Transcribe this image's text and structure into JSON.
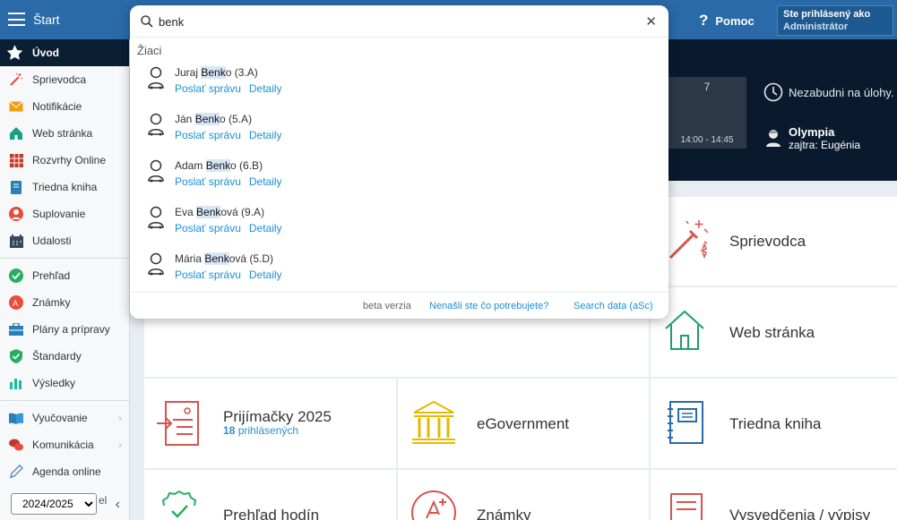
{
  "topbar": {
    "title": "Štart",
    "help_label": "Pomoc",
    "help_icon": "question-icon",
    "login_line1": "Ste prihlásený ako",
    "login_line2": "Administrátor"
  },
  "sidebar": {
    "items": [
      {
        "label": "Úvod",
        "icon": "star-icon",
        "color": "#ffffff"
      },
      {
        "label": "Sprievodca",
        "icon": "wand-icon",
        "color": "#e74c3c"
      },
      {
        "label": "Notifikácie",
        "icon": "envelope-icon",
        "color": "#f39c12"
      },
      {
        "label": "Web stránka",
        "icon": "house-icon",
        "color": "#16a085"
      },
      {
        "label": "Rozvrhy Online",
        "icon": "calendar-grid-icon",
        "color": "#c0392b"
      },
      {
        "label": "Triedna kniha",
        "icon": "book-icon",
        "color": "#2980b9"
      },
      {
        "label": "Suplovanie",
        "icon": "person-icon",
        "color": "#e74c3c"
      },
      {
        "label": "Udalosti",
        "icon": "calendar-icon",
        "color": "#34495e"
      },
      {
        "label": "Prehľad",
        "icon": "check-circle-icon",
        "color": "#27ae60"
      },
      {
        "label": "Známky",
        "icon": "grade-icon",
        "color": "#e74c3c"
      },
      {
        "label": "Plány a prípravy",
        "icon": "briefcase-icon",
        "color": "#2980b9"
      },
      {
        "label": "Štandardy",
        "icon": "shield-icon",
        "color": "#27ae60"
      },
      {
        "label": "Výsledky",
        "icon": "bar-chart-icon",
        "color": "#1abc9c"
      },
      {
        "label": "Vyučovanie",
        "icon": "open-book-icon",
        "color": "#2980b9"
      },
      {
        "label": "Komunikácia",
        "icon": "chat-icon",
        "color": "#c0392b"
      },
      {
        "label": "Agenda online",
        "icon": "pencil-icon",
        "color": "#5d8fc9"
      }
    ],
    "year_selected": "2024/2025",
    "year_options": [
      "2024/2025"
    ],
    "year_extra": "el",
    "collapse_icon": "chevron-left-icon"
  },
  "dark_panel": {
    "period_number": "7",
    "period_time": "14:00 - 14:45",
    "reminder": "Nezabudni na úlohy.",
    "nameday_name": "Olympia",
    "nameday_tomorrow": "zajtra: Eugénia"
  },
  "tiles": {
    "sprievodca": "Sprievodca",
    "web": "Web stránka",
    "prijimacky": "Prijímačky 2025",
    "prijimacky_count": "18",
    "prijimacky_count_label": "prihlásených",
    "egov": "eGovernment",
    "triedna": "Triedna kniha",
    "prehlad_hodin": "Prehľad hodín",
    "znamky": "Známky",
    "vysvedcenia": "Vysvedčenia / výpisy"
  },
  "search": {
    "value": "benk",
    "placeholder": "",
    "section": "Žiaci",
    "results": [
      {
        "pre": "Juraj ",
        "match": "Benk",
        "post": "o (3.A)"
      },
      {
        "pre": "Ján ",
        "match": "Benk",
        "post": "o (5.A)"
      },
      {
        "pre": "Adam ",
        "match": "Benk",
        "post": "o (6.B)"
      },
      {
        "pre": "Eva ",
        "match": "Benk",
        "post": "ová (9.A)"
      },
      {
        "pre": "Mária ",
        "match": "Benk",
        "post": "ová (5.D)"
      }
    ],
    "link_message": "Poslať správu",
    "link_detail": "Detaily",
    "footer_beta": "beta verzia",
    "footer_notfound": "Nenašli ste čo potrebujete?",
    "footer_search_data": "Search data (aSc)"
  }
}
